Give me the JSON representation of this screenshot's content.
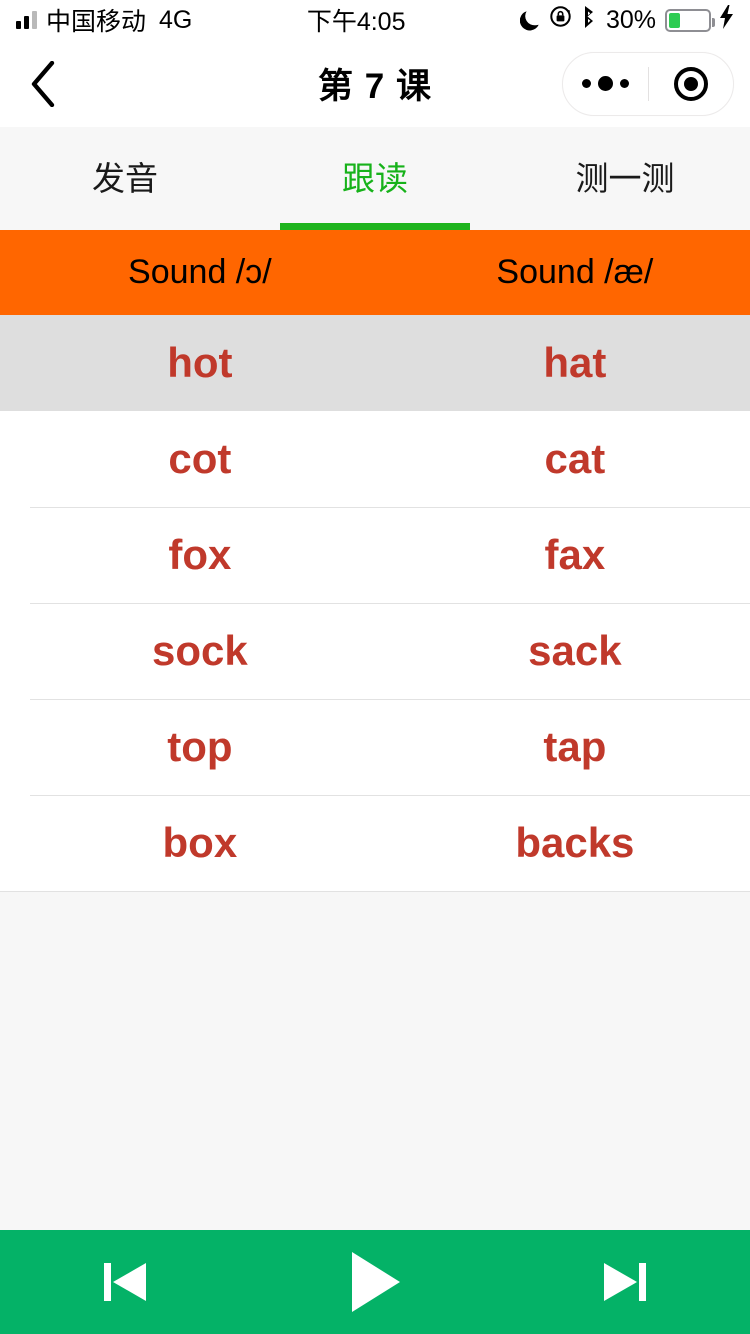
{
  "status_bar": {
    "carrier": "中国移动",
    "network": "4G",
    "time": "下午4:05",
    "battery_percent": "30%",
    "battery_level": 30,
    "icons": [
      "signal-bars-icon",
      "do-not-disturb-moon-icon",
      "rotation-lock-icon",
      "bluetooth-icon",
      "battery-icon",
      "charging-bolt-icon"
    ]
  },
  "nav_bar": {
    "back_icon": "chevron-left-icon",
    "title": "第 7 课",
    "capsule": {
      "menu_icon": "ellipsis-icon",
      "target_icon": "target-circle-icon"
    }
  },
  "tabs": {
    "active_index": 1,
    "items": [
      {
        "label": "发音"
      },
      {
        "label": "跟读"
      },
      {
        "label": "测一测"
      }
    ],
    "active_color": "#1fb41d"
  },
  "sound_header": {
    "background": "#ff6600",
    "columns": [
      "Sound /ɔ/",
      "Sound /æ/"
    ]
  },
  "word_list": {
    "word_color": "#c0392b",
    "selected_row_index": 0,
    "selected_row_background": "#dedede",
    "rows": [
      {
        "left": "hot",
        "right": "hat"
      },
      {
        "left": "cot",
        "right": "cat"
      },
      {
        "left": "fox",
        "right": "fax"
      },
      {
        "left": "sock",
        "right": "sack"
      },
      {
        "left": "top",
        "right": "tap"
      },
      {
        "left": "box",
        "right": "backs"
      }
    ]
  },
  "player": {
    "background": "#04b267",
    "prev_icon": "skip-previous-icon",
    "play_icon": "play-icon",
    "next_icon": "skip-next-icon"
  }
}
